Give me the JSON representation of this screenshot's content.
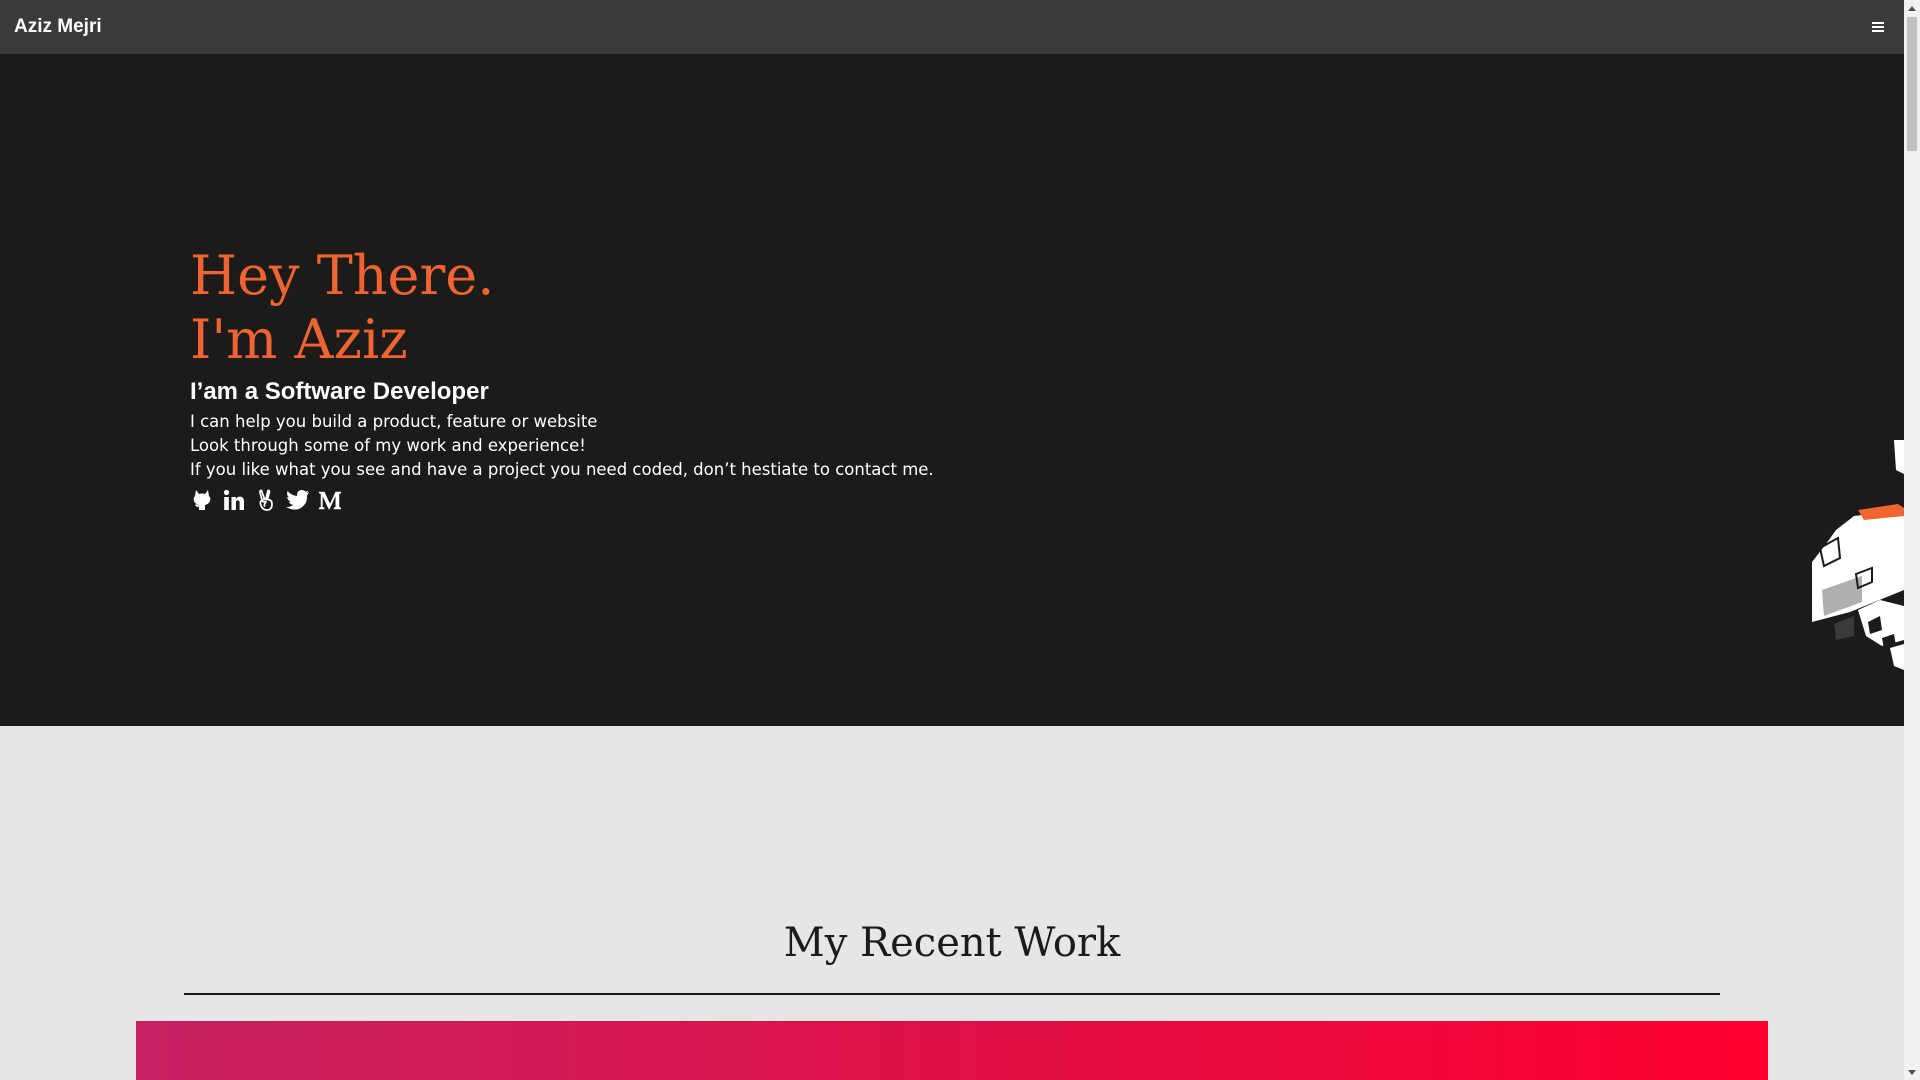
{
  "navbar": {
    "brand": "Aziz Mejri",
    "menu_icon": "hamburger-menu-icon"
  },
  "hero": {
    "greeting_line1": "Hey There.",
    "greeting_line2": "I'm Aziz",
    "role": "I’am a Software Developer",
    "tagline": [
      "I can help you build a product, feature or website",
      "Look through some of my work and experience!",
      "If you like what you see and have a project you need coded, don’t hestiate to contact me."
    ],
    "social_icons": [
      "github-icon",
      "linkedin-icon",
      "angellist-icon",
      "twitter-icon",
      "medium-icon"
    ]
  },
  "work": {
    "title": "My Recent Work"
  },
  "colors": {
    "navbar_bg": "#3b3a39",
    "hero_bg": "#1c1b1a",
    "accent": "#ef6430",
    "work_bg": "#e6e6e6",
    "card_gradient_start": "#c52060",
    "card_gradient_end": "#ff0030"
  }
}
